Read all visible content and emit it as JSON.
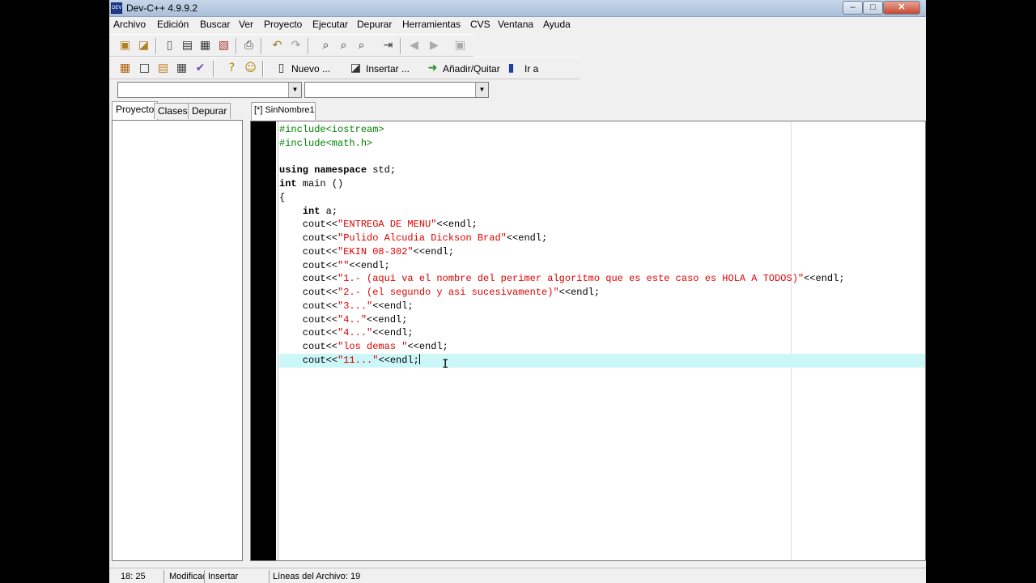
{
  "window": {
    "title": "Dev-C++ 4.9.9.2",
    "icon_label": "DEV"
  },
  "menu": [
    "Archivo",
    "Edición",
    "Buscar",
    "Ver",
    "Proyecto",
    "Ejecutar",
    "Depurar",
    "Herramientas",
    "CVS",
    "Ventana",
    "Ayuda"
  ],
  "toolbar2": {
    "nuevo": "Nuevo ...",
    "insertar": "Insertar ...",
    "anadir": "Añadir/Quitar",
    "ir": "Ir a"
  },
  "left_tabs": [
    "Proyecto",
    "Clases",
    "Depurar"
  ],
  "editor_tab": "[*] SinNombre1",
  "code_lines": [
    {
      "type": "pp",
      "text": "#include<iostream>"
    },
    {
      "type": "pp",
      "text": "#include<math.h>"
    },
    {
      "type": "blank",
      "text": ""
    },
    {
      "type": "mix",
      "parts": [
        [
          "kw",
          "using namespace"
        ],
        [
          "plain",
          " std;"
        ]
      ]
    },
    {
      "type": "mix",
      "parts": [
        [
          "kw",
          "int"
        ],
        [
          "plain",
          " main ()"
        ]
      ]
    },
    {
      "type": "plain",
      "text": "{"
    },
    {
      "type": "mix",
      "parts": [
        [
          "plain",
          "    "
        ],
        [
          "kw",
          "int"
        ],
        [
          "plain",
          " a;"
        ]
      ]
    },
    {
      "type": "mix",
      "parts": [
        [
          "plain",
          "    cout<<"
        ],
        [
          "str",
          "\"ENTREGA DE MENU\""
        ],
        [
          "plain",
          "<<endl;"
        ]
      ]
    },
    {
      "type": "mix",
      "parts": [
        [
          "plain",
          "    cout<<"
        ],
        [
          "str",
          "\"Pulido Alcudia Dickson Brad\""
        ],
        [
          "plain",
          "<<endl;"
        ]
      ]
    },
    {
      "type": "mix",
      "parts": [
        [
          "plain",
          "    cout<<"
        ],
        [
          "str",
          "\"EKIN 08-302\""
        ],
        [
          "plain",
          "<<endl;"
        ]
      ]
    },
    {
      "type": "mix",
      "parts": [
        [
          "plain",
          "    cout<<"
        ],
        [
          "str",
          "\"\""
        ],
        [
          "plain",
          "<<endl;"
        ]
      ]
    },
    {
      "type": "mix",
      "parts": [
        [
          "plain",
          "    cout<<"
        ],
        [
          "str",
          "\"1.- (aqui va el nombre del perimer algoritmo que es este caso es HOLA A TODOS)\""
        ],
        [
          "plain",
          "<<endl;"
        ]
      ]
    },
    {
      "type": "mix",
      "parts": [
        [
          "plain",
          "    cout<<"
        ],
        [
          "str",
          "\"2.- (el segundo y asi sucesivamente)\""
        ],
        [
          "plain",
          "<<endl;"
        ]
      ]
    },
    {
      "type": "mix",
      "parts": [
        [
          "plain",
          "    cout<<"
        ],
        [
          "str",
          "\"3...\""
        ],
        [
          "plain",
          "<<endl;"
        ]
      ]
    },
    {
      "type": "mix",
      "parts": [
        [
          "plain",
          "    cout<<"
        ],
        [
          "str",
          "\"4..\""
        ],
        [
          "plain",
          "<<endl;"
        ]
      ]
    },
    {
      "type": "mix",
      "parts": [
        [
          "plain",
          "    cout<<"
        ],
        [
          "str",
          "\"4...\""
        ],
        [
          "plain",
          "<<endl;"
        ]
      ]
    },
    {
      "type": "mix",
      "parts": [
        [
          "plain",
          "    cout<<"
        ],
        [
          "str",
          "\"los demas \""
        ],
        [
          "plain",
          "<<endl;"
        ]
      ]
    },
    {
      "type": "mix",
      "active": true,
      "caret": true,
      "parts": [
        [
          "plain",
          "    cout<<"
        ],
        [
          "str",
          "\"11...\""
        ],
        [
          "plain",
          "<<endl;"
        ]
      ]
    }
  ],
  "status": {
    "position": "18: 25",
    "modified": "Modificado",
    "mode": "Insertar",
    "lines": "Líneas del Archivo: 19"
  }
}
